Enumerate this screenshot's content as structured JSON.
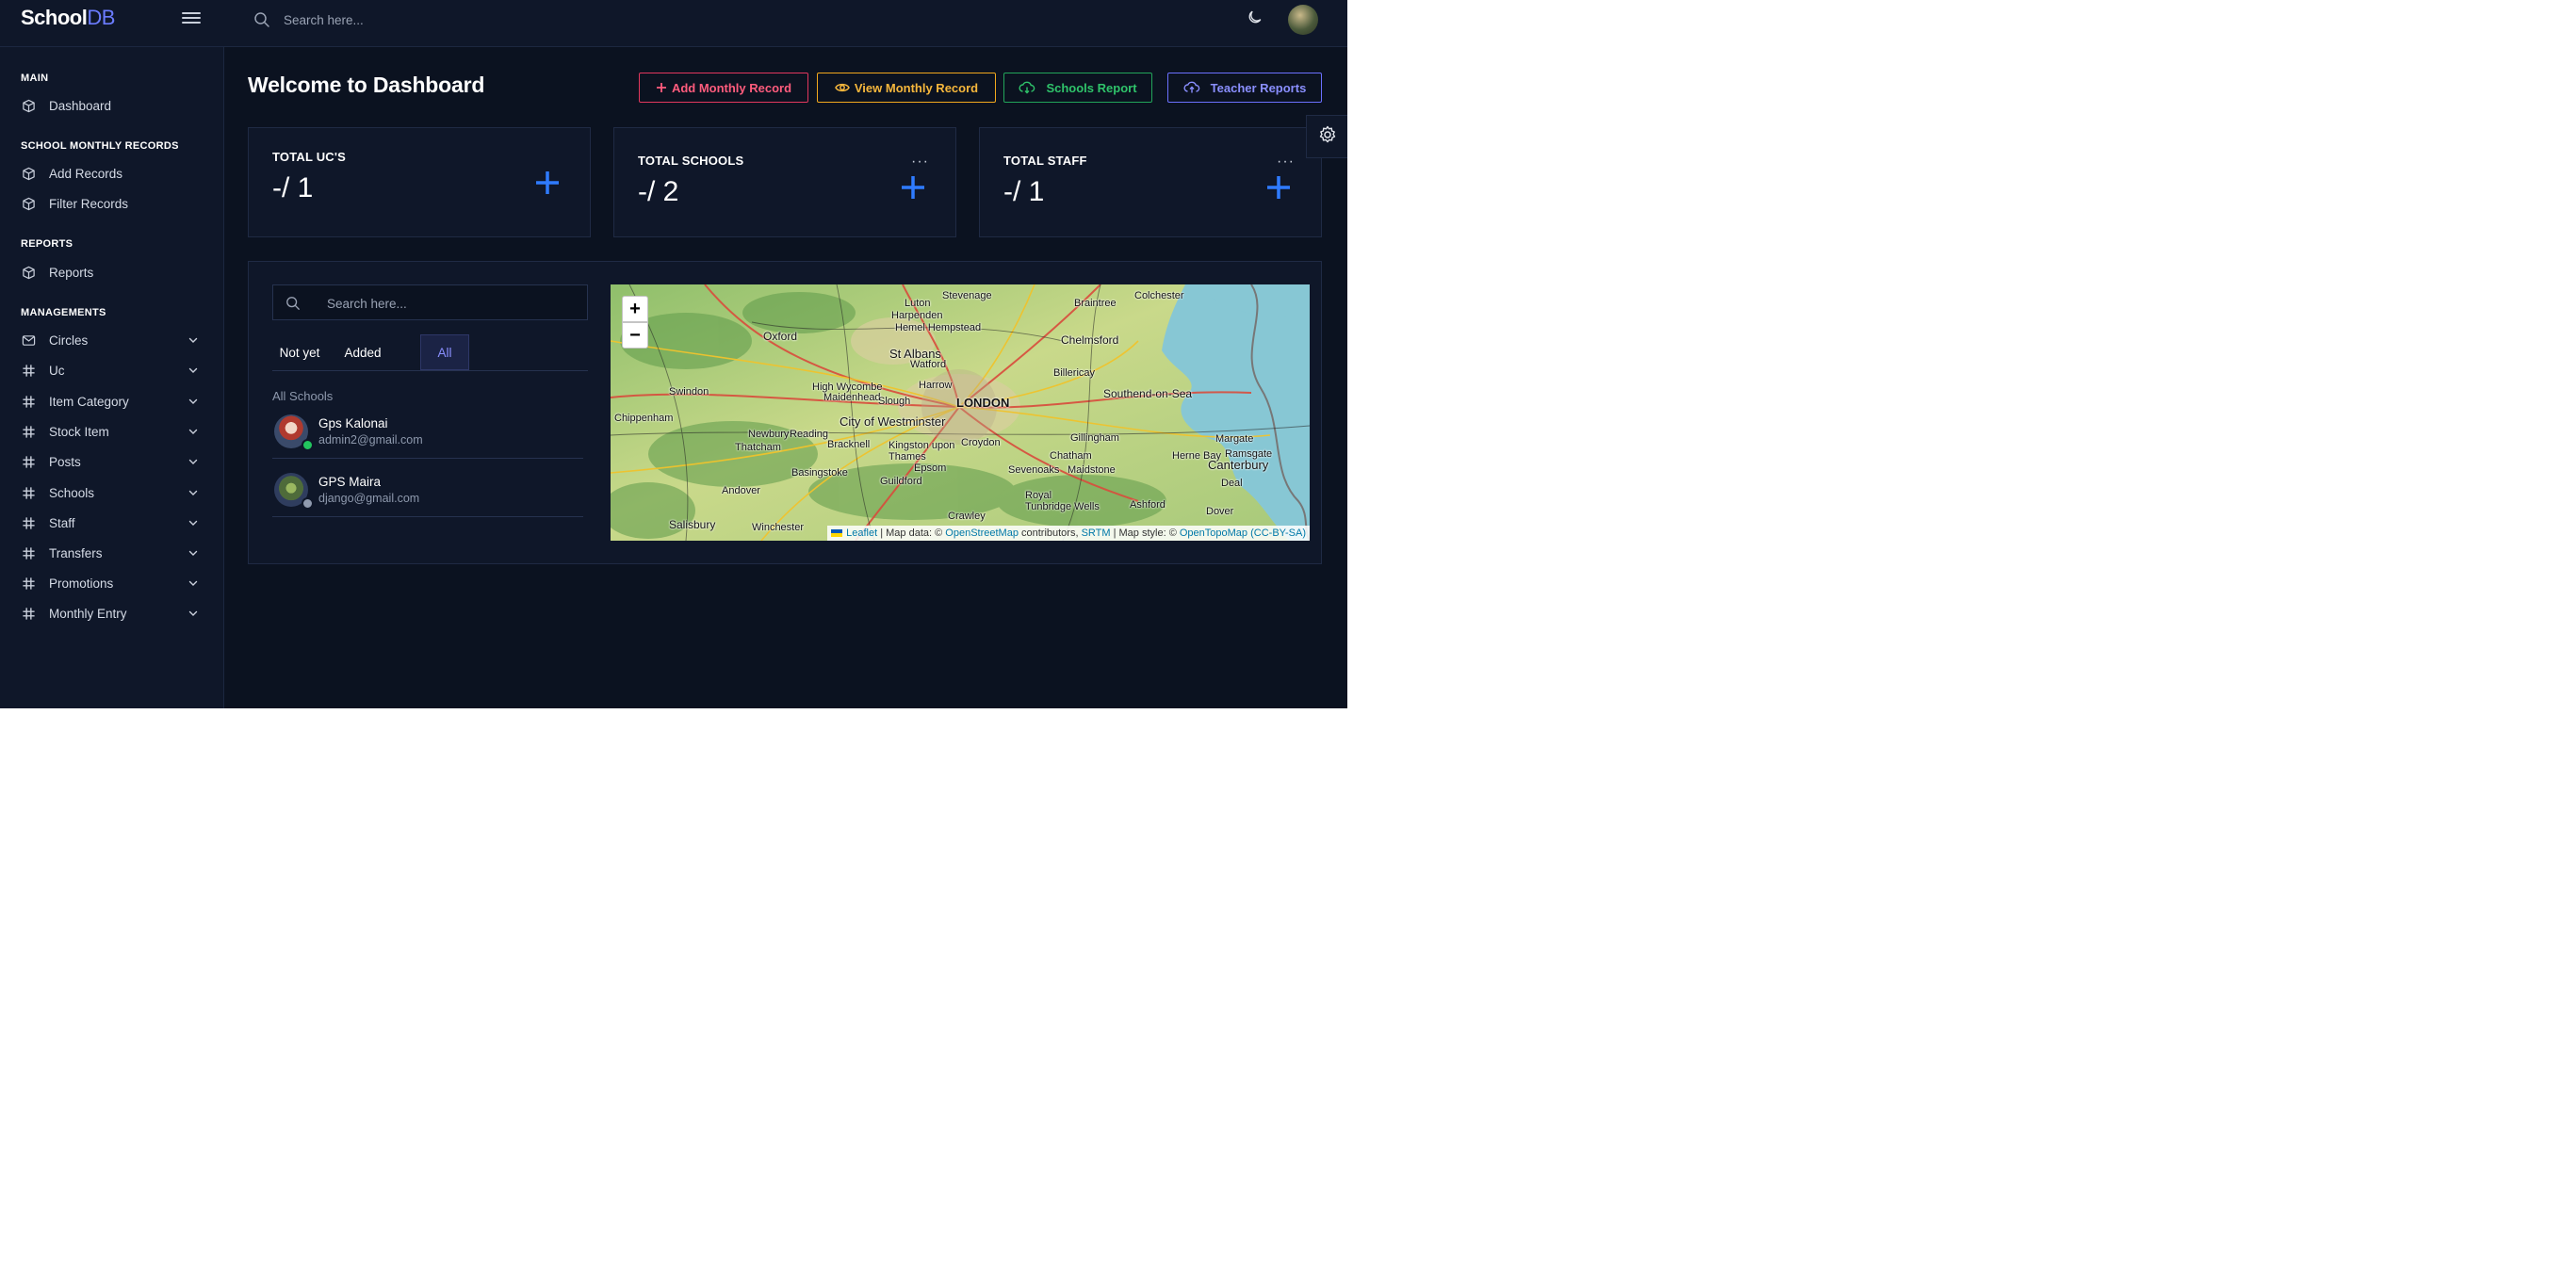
{
  "brand": {
    "name": "School",
    "suffix": "DB"
  },
  "topbar": {
    "search_placeholder": "Search here..."
  },
  "sidebar": {
    "sections": [
      {
        "title": "MAIN"
      },
      {
        "title": "SCHOOL MONTHLY RECORDS"
      },
      {
        "title": "REPORTS"
      },
      {
        "title": "MANAGEMENTS"
      }
    ],
    "items": [
      {
        "label": "Dashboard"
      },
      {
        "label": "Add Records"
      },
      {
        "label": "Filter Records"
      },
      {
        "label": "Reports"
      },
      {
        "label": "Circles"
      },
      {
        "label": "Uc"
      },
      {
        "label": "Item Category"
      },
      {
        "label": "Stock Item"
      },
      {
        "label": "Posts"
      },
      {
        "label": "Schools"
      },
      {
        "label": "Staff"
      },
      {
        "label": "Transfers"
      },
      {
        "label": "Promotions"
      },
      {
        "label": "Monthly Entry"
      }
    ]
  },
  "main": {
    "title": "Welcome to Dashboard",
    "buttons": {
      "add_monthly": "Add Monthly Record",
      "view_monthly": "View Monthly Record",
      "schools_report": "Schools Report",
      "teacher_reports": "Teacher Reports"
    },
    "cards": [
      {
        "title": "TOTAL UC'S",
        "value": "-/ 1"
      },
      {
        "title": "TOTAL SCHOOLS",
        "value": "-/ 2"
      },
      {
        "title": "TOTAL STAFF",
        "value": "-/ 1"
      }
    ],
    "cards_menu": "···",
    "list": {
      "search_placeholder": "Search here...",
      "tabs": [
        {
          "label": "Not yet"
        },
        {
          "label": "Added"
        },
        {
          "label": "All"
        }
      ],
      "active_tab": "All",
      "heading": "All Schools",
      "schools": [
        {
          "name": "Gps Kalonai",
          "email": "admin2@gmail.com"
        },
        {
          "name": "GPS Maira",
          "email": "django@gmail.com"
        }
      ]
    },
    "map": {
      "zoom_in": "+",
      "zoom_out": "−",
      "places": [
        "Colchester",
        "Braintree",
        "Stevenage",
        "Luton",
        "Harpenden",
        "Hemel Hempstead",
        "St Albans",
        "Chelmsford",
        "Oxford",
        "Watford",
        "Harrow",
        "Billericay",
        "High Wycombe",
        "Maidenhead",
        "Slough",
        "Southend-on-Sea",
        "Swindon",
        "LONDON",
        "Chippenham",
        "City of Westminster",
        "Newbury",
        "Reading",
        "Bracknell",
        "Croydon",
        "Gillingham",
        "Margate",
        "Thatcham",
        "Kingston upon Thames",
        "Chatham",
        "Herne Bay",
        "Ramsgate",
        "Basingstoke",
        "Sevenoaks",
        "Maidstone",
        "Canterbury",
        "Epsom",
        "Guildford",
        "Deal",
        "Andover",
        "Royal Tunbridge Wells",
        "Ashford",
        "Dover",
        "Salisbury",
        "Winchester",
        "Crawley"
      ],
      "attribution": {
        "leaflet": "Leaflet",
        "sep1": " | Map data: © ",
        "osm": "OpenStreetMap",
        "sep2": " contributors, ",
        "srtm": "SRTM",
        "sep3": " | Map style: © ",
        "otm": "OpenTopoMap",
        "sep4": " ",
        "license": "(CC-BY-SA)"
      }
    }
  },
  "colors": {
    "background": "#0b1220",
    "panel": "#0f1729",
    "accent": "#6b7cff",
    "danger": "#e2375d",
    "warning": "#f2a81d",
    "success": "#22a55a",
    "plus_icon": "#2f7bff"
  }
}
